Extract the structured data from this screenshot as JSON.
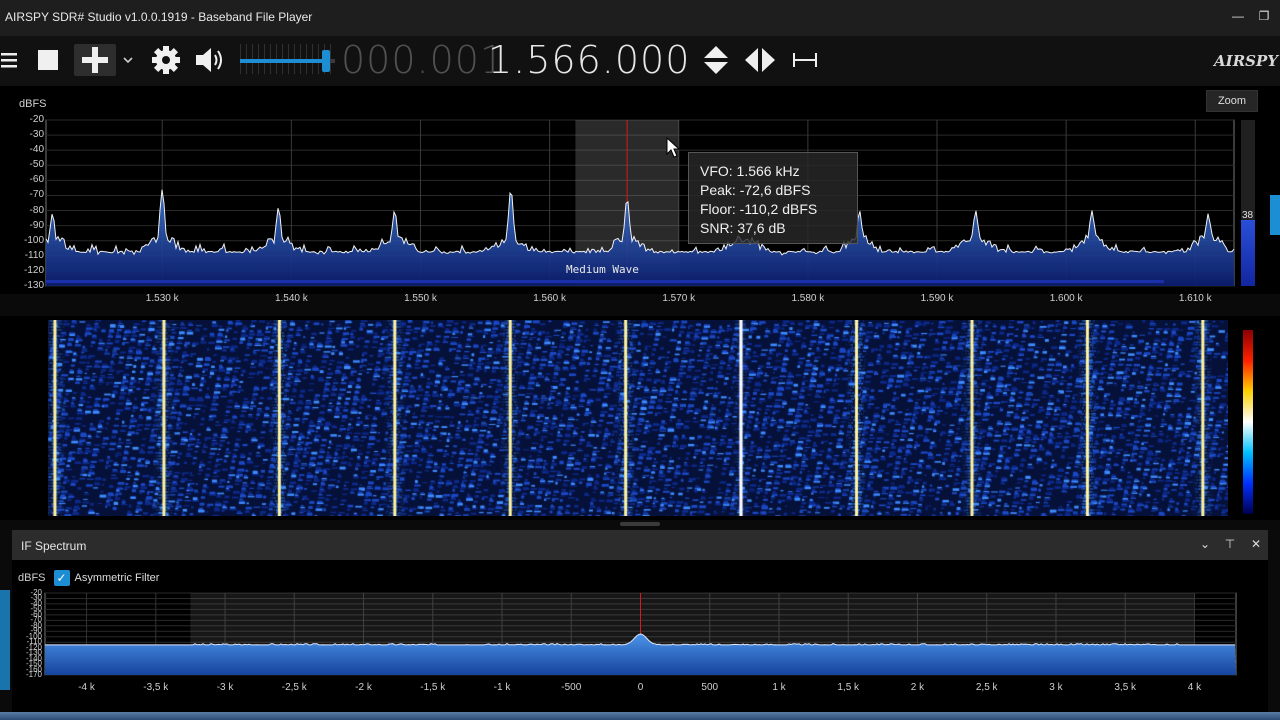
{
  "window": {
    "title": "AIRSPY SDR# Studio v1.0.0.1919 - Baseband File Player",
    "minimize_icon": "minimize-icon",
    "restore_icon": "restore-icon"
  },
  "toolbar": {
    "icons": [
      "menu-icon",
      "stop-icon",
      "add-icon",
      "chevron-down-icon",
      "gear-icon",
      "speaker-icon",
      "up-down-arrows-icon",
      "left-right-arrows-icon",
      "span-icon"
    ],
    "volume_level": 0.9,
    "frequency_dim": "000.001",
    "frequency_main": "1.566.000",
    "brand": "AIRSPY",
    "accent": "#1e8ed4"
  },
  "spectrum": {
    "ylabel": "dBFS",
    "yticks": [
      "-20",
      "-30",
      "-40",
      "-50",
      "-60",
      "-70",
      "-80",
      "-90",
      "-100",
      "-110",
      "-120",
      "-130"
    ],
    "xticks": [
      "1.530 k",
      "1.540 k",
      "1.550 k",
      "1.560 k",
      "1.570 k",
      "1.580 k",
      "1.590 k",
      "1.600 k",
      "1.610 k"
    ],
    "zoom_label": "Zoom",
    "band_label": "Medium Wave",
    "signal_value": "38",
    "signal_level": 0.4,
    "tooltip": {
      "vfo": "VFO:  1.566 kHz",
      "peak": "Peak: -72,6 dBFS",
      "floor": "Floor: -110,2 dBFS",
      "snr": "SNR:  37,6 dB"
    }
  },
  "if_spectrum": {
    "title": "IF Spectrum",
    "header_icons": [
      "chevron-down-icon",
      "pin-icon",
      "close-icon"
    ],
    "ylabel": "dBFS",
    "checkbox_label": "Asymmetric Filter",
    "checkbox_checked": true,
    "yticks": [
      "-20",
      "-30",
      "-40",
      "-50",
      "-60",
      "-70",
      "-80",
      "-90",
      "-100",
      "-110",
      "-120",
      "-130",
      "-140",
      "-150",
      "-160",
      "-170"
    ],
    "xticks": [
      "-4 k",
      "-3,5 k",
      "-3 k",
      "-2,5 k",
      "-2 k",
      "-1,5 k",
      "-1 k",
      "-500",
      "0",
      "500",
      "1 k",
      "1,5 k",
      "2 k",
      "2,5 k",
      "3 k",
      "3,5 k",
      "4 k"
    ]
  },
  "chart_data": [
    {
      "type": "area",
      "ylabel": "dBFS",
      "ylim": [
        -130,
        -20
      ],
      "xlim": [
        1521,
        1613
      ],
      "grid": true,
      "x_unit": "kHz",
      "series": [
        {
          "peaks_x": [
            1521.5,
            1530,
            1539,
            1548,
            1557,
            1566,
            1575,
            1584,
            1593,
            1602,
            1611
          ],
          "peaks_y": [
            -82,
            -66,
            -78,
            -80,
            -66,
            -72,
            -102,
            -80,
            -80,
            -80,
            -82
          ],
          "floor": -110
        }
      ],
      "vfo_x": 1566,
      "filter_range": [
        1562,
        1570
      ]
    },
    {
      "type": "area",
      "ylabel": "dBFS",
      "ylim": [
        -170,
        -20
      ],
      "xlim": [
        -4.3,
        4.3
      ],
      "grid": true,
      "x_unit": "kHz",
      "series": [
        {
          "passband": [
            -3.25,
            3.9
          ],
          "level": -115,
          "peak_x": 0,
          "peak_y": -95
        }
      ],
      "filter_range": [
        -3.25,
        4
      ]
    }
  ]
}
